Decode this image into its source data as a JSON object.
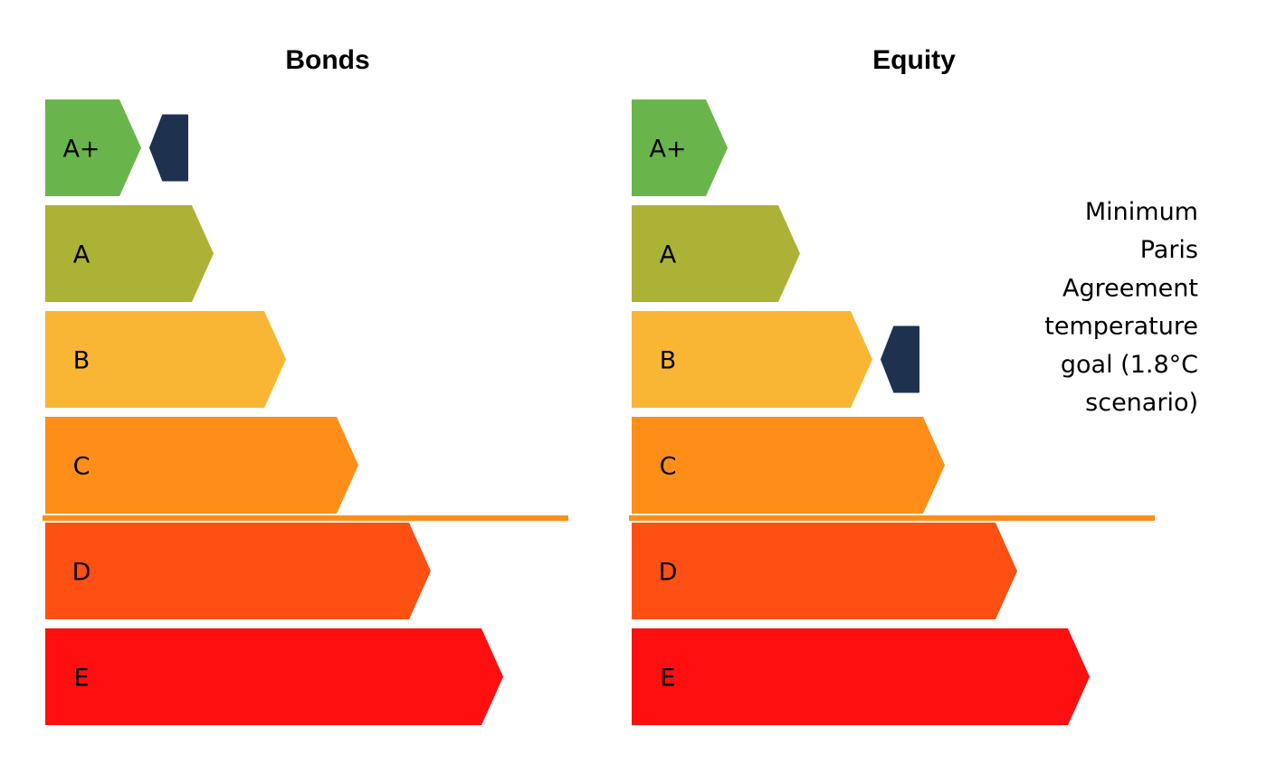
{
  "chart_data": {
    "type": "bar",
    "categories": [
      "A+",
      "A",
      "B",
      "C",
      "D",
      "E"
    ],
    "colors": {
      "A+": "#6ab44c",
      "A": "#acb236",
      "B": "#f9b634",
      "C": "#fe8e17",
      "D": "#ff5014",
      "E": "#ff0f0f",
      "threshold": "#fe8e17",
      "marker": "#1e3250"
    },
    "threshold_between": [
      "C",
      "D"
    ],
    "panels": [
      {
        "title": "Bonds",
        "marker_category": "A+"
      },
      {
        "title": "Equity",
        "marker_category": "B"
      }
    ],
    "annotation": {
      "lines": [
        "Minimum",
        "Paris",
        "Agreement",
        "temperature",
        "goal (1.8°C",
        "scenario)"
      ]
    }
  }
}
